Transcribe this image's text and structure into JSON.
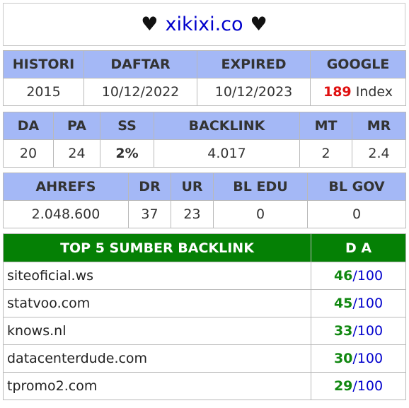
{
  "title": {
    "left_heart": "♥",
    "domain": "xikixi.co",
    "right_heart": "♥"
  },
  "table1": {
    "headers": [
      "HISTORI",
      "DAFTAR",
      "EXPIRED",
      "GOOGLE"
    ],
    "values": [
      "2015",
      "10/12/2022",
      "10/12/2023"
    ],
    "google_count": "189",
    "google_suffix": "Index"
  },
  "table2": {
    "headers": [
      "DA",
      "PA",
      "SS",
      "BACKLINK",
      "MT",
      "MR"
    ],
    "values": [
      "20",
      "24",
      "2%",
      "4.017",
      "2",
      "2.4"
    ]
  },
  "table3": {
    "headers": [
      "AHREFS",
      "DR",
      "UR",
      "BL EDU",
      "BL GOV"
    ],
    "values": [
      "2.048.600",
      "37",
      "23",
      "0",
      "0"
    ]
  },
  "backlinks": {
    "header_source": "TOP 5 SUMBER BACKLINK",
    "header_da": "D A",
    "rows": [
      {
        "site": "siteoficial.ws",
        "da": "46",
        "max": "/100"
      },
      {
        "site": "statvoo.com",
        "da": "45",
        "max": "/100"
      },
      {
        "site": "knows.nl",
        "da": "33",
        "max": "/100"
      },
      {
        "site": "datacenterdude.com",
        "da": "30",
        "max": "/100"
      },
      {
        "site": "tpromo2.com",
        "da": "29",
        "max": "/100"
      }
    ]
  },
  "colors": {
    "header_blue": "#a4b8f6",
    "header_green": "#058005",
    "domain_blue": "#0000cc",
    "accent_red": "#e01010",
    "accent_green": "#118811"
  }
}
